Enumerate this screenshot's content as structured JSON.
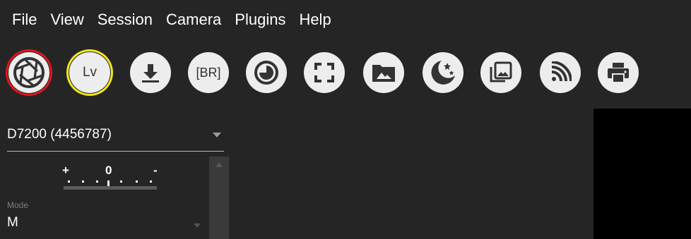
{
  "menu": [
    "File",
    "View",
    "Session",
    "Camera",
    "Plugins",
    "Help"
  ],
  "toolbar": {
    "buttons": [
      {
        "name": "capture-button",
        "icon": "aperture-icon",
        "ring": "#e3141c"
      },
      {
        "name": "liveview-button",
        "icon": "lv-text",
        "label": "Lv",
        "ring": "#f1e81a"
      },
      {
        "name": "download-button",
        "icon": "download-icon"
      },
      {
        "name": "bracketing-button",
        "icon": "br-text",
        "label": "[BR]"
      },
      {
        "name": "timelapse-button",
        "icon": "timer-icon"
      },
      {
        "name": "fullscreen-button",
        "icon": "fullscreen-icon"
      },
      {
        "name": "browse-button",
        "icon": "folder-image-icon"
      },
      {
        "name": "astro-button",
        "icon": "moon-stars-icon"
      },
      {
        "name": "gallery-button",
        "icon": "gallery-icon"
      },
      {
        "name": "wifi-button",
        "icon": "rss-icon"
      },
      {
        "name": "print-button",
        "icon": "printer-icon"
      }
    ]
  },
  "camera": {
    "name": "D7200 (4456787)"
  },
  "exposure_scale": {
    "plus": "+",
    "zero": "0",
    "minus": "-"
  },
  "mode": {
    "label": "Mode",
    "value": "M"
  }
}
